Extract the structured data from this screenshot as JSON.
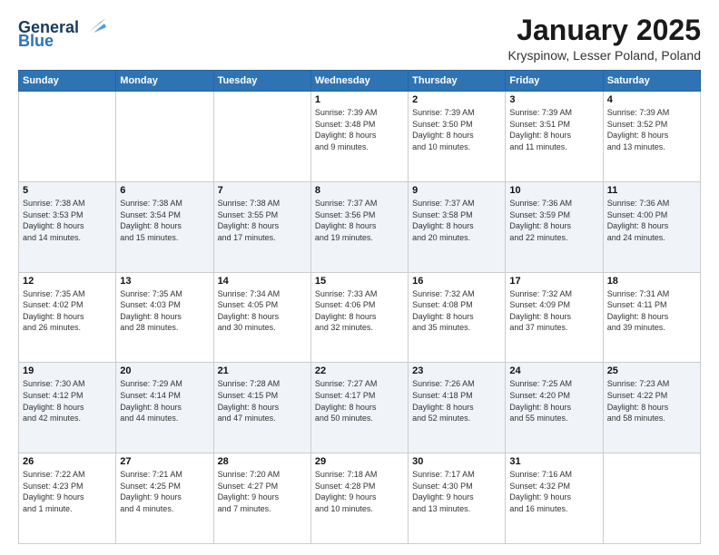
{
  "header": {
    "logo_line1": "General",
    "logo_line2": "Blue",
    "month": "January 2025",
    "location": "Kryspinow, Lesser Poland, Poland"
  },
  "weekdays": [
    "Sunday",
    "Monday",
    "Tuesday",
    "Wednesday",
    "Thursday",
    "Friday",
    "Saturday"
  ],
  "weeks": [
    [
      {
        "day": "",
        "info": ""
      },
      {
        "day": "",
        "info": ""
      },
      {
        "day": "",
        "info": ""
      },
      {
        "day": "1",
        "info": "Sunrise: 7:39 AM\nSunset: 3:48 PM\nDaylight: 8 hours\nand 9 minutes."
      },
      {
        "day": "2",
        "info": "Sunrise: 7:39 AM\nSunset: 3:50 PM\nDaylight: 8 hours\nand 10 minutes."
      },
      {
        "day": "3",
        "info": "Sunrise: 7:39 AM\nSunset: 3:51 PM\nDaylight: 8 hours\nand 11 minutes."
      },
      {
        "day": "4",
        "info": "Sunrise: 7:39 AM\nSunset: 3:52 PM\nDaylight: 8 hours\nand 13 minutes."
      }
    ],
    [
      {
        "day": "5",
        "info": "Sunrise: 7:38 AM\nSunset: 3:53 PM\nDaylight: 8 hours\nand 14 minutes."
      },
      {
        "day": "6",
        "info": "Sunrise: 7:38 AM\nSunset: 3:54 PM\nDaylight: 8 hours\nand 15 minutes."
      },
      {
        "day": "7",
        "info": "Sunrise: 7:38 AM\nSunset: 3:55 PM\nDaylight: 8 hours\nand 17 minutes."
      },
      {
        "day": "8",
        "info": "Sunrise: 7:37 AM\nSunset: 3:56 PM\nDaylight: 8 hours\nand 19 minutes."
      },
      {
        "day": "9",
        "info": "Sunrise: 7:37 AM\nSunset: 3:58 PM\nDaylight: 8 hours\nand 20 minutes."
      },
      {
        "day": "10",
        "info": "Sunrise: 7:36 AM\nSunset: 3:59 PM\nDaylight: 8 hours\nand 22 minutes."
      },
      {
        "day": "11",
        "info": "Sunrise: 7:36 AM\nSunset: 4:00 PM\nDaylight: 8 hours\nand 24 minutes."
      }
    ],
    [
      {
        "day": "12",
        "info": "Sunrise: 7:35 AM\nSunset: 4:02 PM\nDaylight: 8 hours\nand 26 minutes."
      },
      {
        "day": "13",
        "info": "Sunrise: 7:35 AM\nSunset: 4:03 PM\nDaylight: 8 hours\nand 28 minutes."
      },
      {
        "day": "14",
        "info": "Sunrise: 7:34 AM\nSunset: 4:05 PM\nDaylight: 8 hours\nand 30 minutes."
      },
      {
        "day": "15",
        "info": "Sunrise: 7:33 AM\nSunset: 4:06 PM\nDaylight: 8 hours\nand 32 minutes."
      },
      {
        "day": "16",
        "info": "Sunrise: 7:32 AM\nSunset: 4:08 PM\nDaylight: 8 hours\nand 35 minutes."
      },
      {
        "day": "17",
        "info": "Sunrise: 7:32 AM\nSunset: 4:09 PM\nDaylight: 8 hours\nand 37 minutes."
      },
      {
        "day": "18",
        "info": "Sunrise: 7:31 AM\nSunset: 4:11 PM\nDaylight: 8 hours\nand 39 minutes."
      }
    ],
    [
      {
        "day": "19",
        "info": "Sunrise: 7:30 AM\nSunset: 4:12 PM\nDaylight: 8 hours\nand 42 minutes."
      },
      {
        "day": "20",
        "info": "Sunrise: 7:29 AM\nSunset: 4:14 PM\nDaylight: 8 hours\nand 44 minutes."
      },
      {
        "day": "21",
        "info": "Sunrise: 7:28 AM\nSunset: 4:15 PM\nDaylight: 8 hours\nand 47 minutes."
      },
      {
        "day": "22",
        "info": "Sunrise: 7:27 AM\nSunset: 4:17 PM\nDaylight: 8 hours\nand 50 minutes."
      },
      {
        "day": "23",
        "info": "Sunrise: 7:26 AM\nSunset: 4:18 PM\nDaylight: 8 hours\nand 52 minutes."
      },
      {
        "day": "24",
        "info": "Sunrise: 7:25 AM\nSunset: 4:20 PM\nDaylight: 8 hours\nand 55 minutes."
      },
      {
        "day": "25",
        "info": "Sunrise: 7:23 AM\nSunset: 4:22 PM\nDaylight: 8 hours\nand 58 minutes."
      }
    ],
    [
      {
        "day": "26",
        "info": "Sunrise: 7:22 AM\nSunset: 4:23 PM\nDaylight: 9 hours\nand 1 minute."
      },
      {
        "day": "27",
        "info": "Sunrise: 7:21 AM\nSunset: 4:25 PM\nDaylight: 9 hours\nand 4 minutes."
      },
      {
        "day": "28",
        "info": "Sunrise: 7:20 AM\nSunset: 4:27 PM\nDaylight: 9 hours\nand 7 minutes."
      },
      {
        "day": "29",
        "info": "Sunrise: 7:18 AM\nSunset: 4:28 PM\nDaylight: 9 hours\nand 10 minutes."
      },
      {
        "day": "30",
        "info": "Sunrise: 7:17 AM\nSunset: 4:30 PM\nDaylight: 9 hours\nand 13 minutes."
      },
      {
        "day": "31",
        "info": "Sunrise: 7:16 AM\nSunset: 4:32 PM\nDaylight: 9 hours\nand 16 minutes."
      },
      {
        "day": "",
        "info": ""
      }
    ]
  ]
}
